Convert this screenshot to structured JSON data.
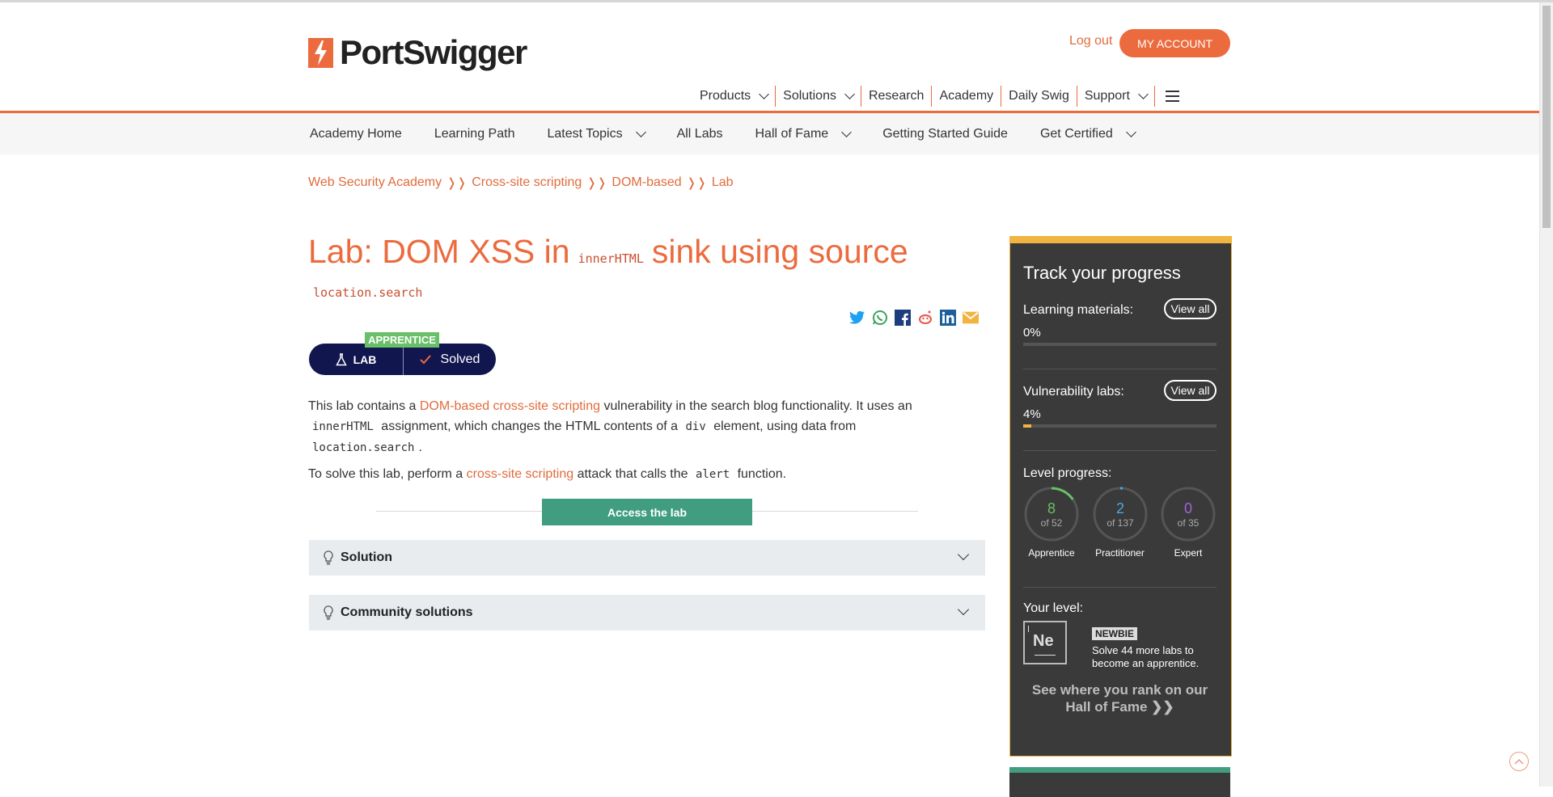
{
  "header": {
    "brand": "PortSwigger",
    "logout": "Log out",
    "my_account": "MY ACCOUNT",
    "nav": [
      "Products",
      "Solutions",
      "Research",
      "Academy",
      "Daily Swig",
      "Support"
    ]
  },
  "subnav": [
    "Academy Home",
    "Learning Path",
    "Latest Topics",
    "All Labs",
    "Hall of Fame",
    "Getting Started Guide",
    "Get Certified"
  ],
  "breadcrumb": [
    "Web Security Academy",
    "Cross-site scripting",
    "DOM-based",
    "Lab"
  ],
  "title": {
    "prefix": "Lab: DOM XSS in",
    "code1": "innerHTML",
    "middle": "sink using source",
    "code2": "location.search"
  },
  "lab": {
    "level": "APPRENTICE",
    "label": "LAB",
    "status": "Solved"
  },
  "description": {
    "p1_a": "This lab contains a ",
    "p1_link": "DOM-based cross-site scripting",
    "p1_b": " vulnerability in the search blog functionality. It uses an ",
    "p1_code1": "innerHTML",
    "p1_c": " assignment, which changes the HTML contents of a ",
    "p1_code2": "div",
    "p1_d": " element, using data from ",
    "p1_code3": "location.search",
    "p1_e": ".",
    "p2_a": "To solve this lab, perform a ",
    "p2_link": "cross-site scripting",
    "p2_b": " attack that calls the ",
    "p2_code": "alert",
    "p2_c": " function."
  },
  "access_button": "Access the lab",
  "accordions": [
    "Solution",
    "Community solutions"
  ],
  "panel": {
    "title": "Track your progress",
    "learning_label": "Learning materials:",
    "learning_pct": "0%",
    "learning_fill": 0,
    "view_all": "View all",
    "vuln_label": "Vulnerability labs:",
    "vuln_pct": "4%",
    "vuln_fill": 0.04,
    "level_progress": "Level progress:",
    "rings": [
      {
        "count": "8",
        "of": "of 52",
        "label": "Apprentice",
        "color": "#6abf69",
        "fraction": 0.154
      },
      {
        "count": "2",
        "of": "of 137",
        "label": "Practitioner",
        "color": "#4aa8e8",
        "fraction": 0.015
      },
      {
        "count": "0",
        "of": "of 35",
        "label": "Expert",
        "color": "#a064d6",
        "fraction": 0
      }
    ],
    "your_level": "Your level:",
    "element": "Ne",
    "badge": "NEWBIE",
    "level_text": "Solve 44 more labs to become an apprentice.",
    "rank": "See where you rank on our Hall of Fame"
  },
  "colors": {
    "accent": "#ec6b3e",
    "navy": "#11164f",
    "green": "#409d80",
    "gold": "#f1b341"
  }
}
